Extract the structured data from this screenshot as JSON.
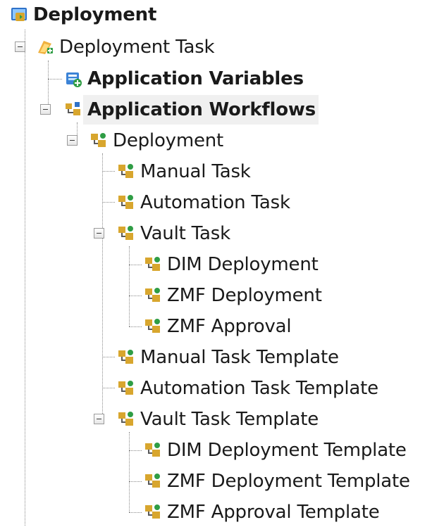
{
  "tree": {
    "root": {
      "label": "Deployment",
      "icon": "deployment-root-icon"
    },
    "deployment_task": {
      "label": "Deployment Task",
      "icon": "deployment-task-icon",
      "expanded": true
    },
    "application_variables": {
      "label": "Application Variables",
      "icon": "application-variables-icon"
    },
    "application_workflows": {
      "label": "Application Workflows",
      "icon": "application-workflows-icon",
      "expanded": true,
      "selected": true
    },
    "workflow_deployment": {
      "label": "Deployment",
      "icon": "workflow-icon",
      "expanded": true
    },
    "manual_task": {
      "label": "Manual Task",
      "icon": "workflow-icon"
    },
    "automation_task": {
      "label": "Automation Task",
      "icon": "workflow-icon"
    },
    "vault_task": {
      "label": "Vault Task",
      "icon": "workflow-icon",
      "expanded": true
    },
    "dim_deployment": {
      "label": "DIM Deployment",
      "icon": "workflow-icon"
    },
    "zmf_deployment": {
      "label": "ZMF Deployment",
      "icon": "workflow-icon"
    },
    "zmf_approval": {
      "label": "ZMF Approval",
      "icon": "workflow-icon"
    },
    "manual_task_template": {
      "label": "Manual Task Template",
      "icon": "workflow-icon"
    },
    "automation_task_template": {
      "label": "Automation Task Template",
      "icon": "workflow-icon"
    },
    "vault_task_template": {
      "label": "Vault Task Template",
      "icon": "workflow-icon",
      "expanded": true
    },
    "dim_deployment_template": {
      "label": "DIM Deployment Template",
      "icon": "workflow-icon"
    },
    "zmf_deployment_template": {
      "label": "ZMF Deployment Template",
      "icon": "workflow-icon"
    },
    "zmf_approval_template": {
      "label": "ZMF Approval Template",
      "icon": "workflow-icon"
    }
  },
  "colors": {
    "tree_line": "#8a8a8a",
    "selection_background": "#f0f0f0",
    "icon_gold": "#d8a62e",
    "icon_green": "#2f9d45",
    "icon_blue": "#2f72c8"
  }
}
